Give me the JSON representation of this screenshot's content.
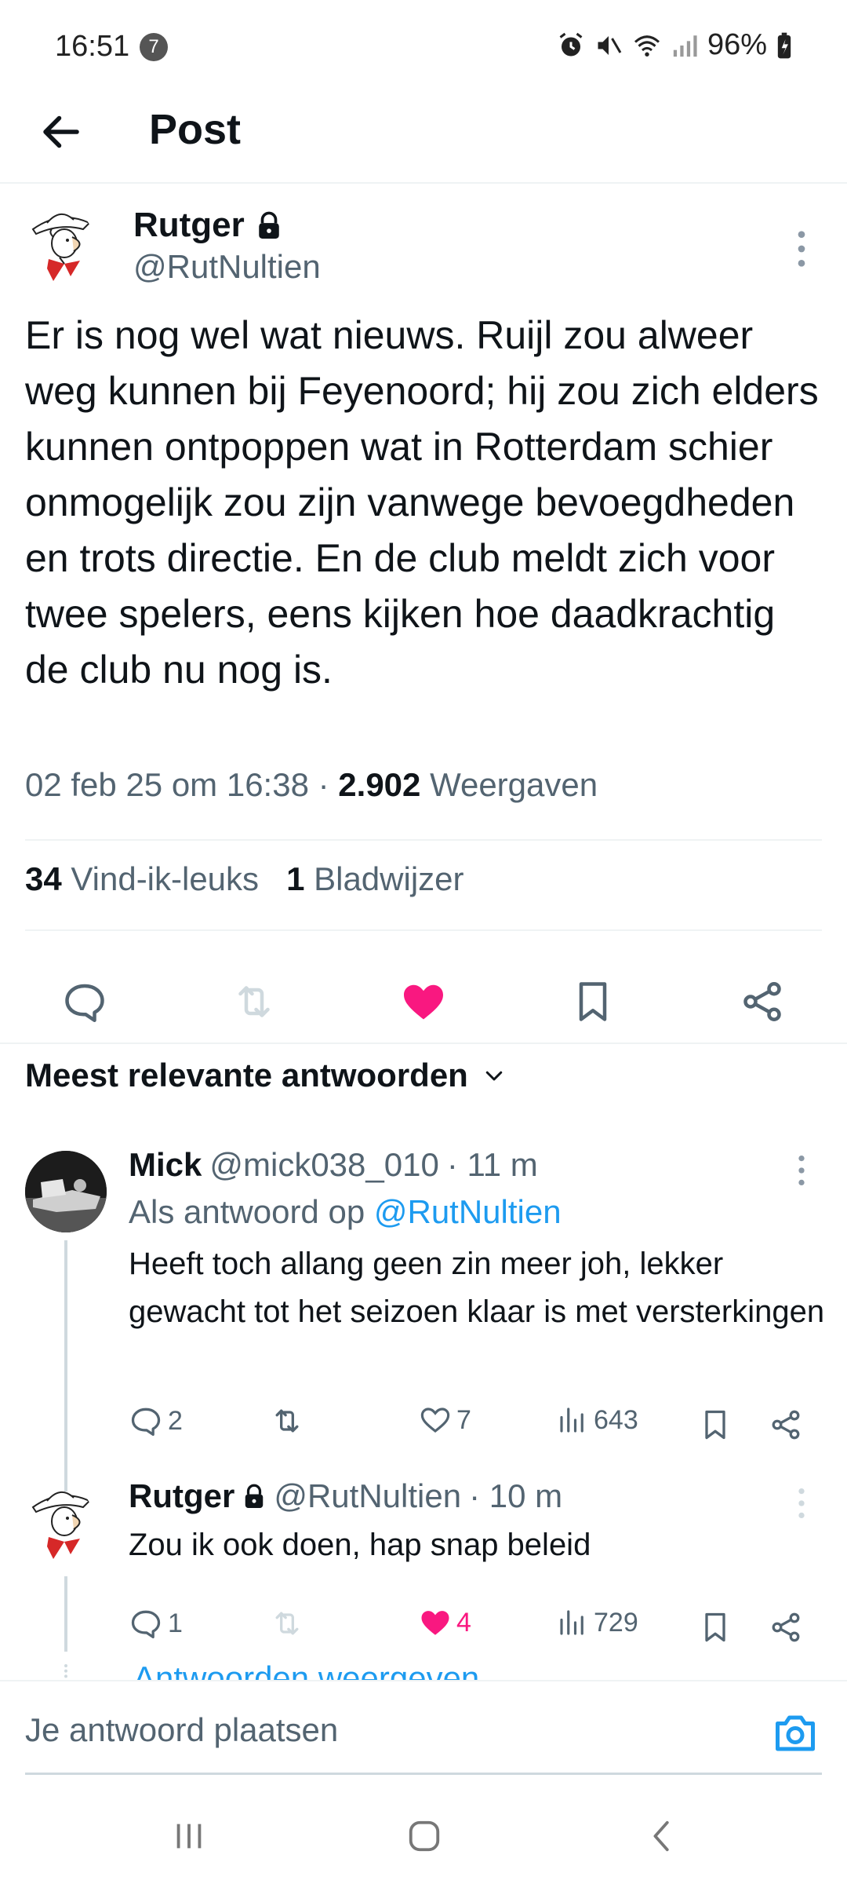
{
  "status_bar": {
    "time": "16:51",
    "notification_count": "7",
    "battery": "96%"
  },
  "header": {
    "title": "Post"
  },
  "post": {
    "author_name": "Rutger",
    "handle": "@RutNultien",
    "text": "Er is nog wel wat nieuws. Ruijl zou alweer weg kunnen bij Feyenoord; hij zou zich elders kunnen ontpoppen wat in Rotterdam schier onmogelijk zou zijn vanwege bevoegdheden en trots directie. En de club meldt zich voor twee spelers, eens kijken hoe daadkrachtig de club nu nog is.",
    "timestamp": "02 feb 25 om 16:38",
    "separator": "·",
    "views_count": "2.902",
    "views_label": "Weergaven",
    "likes_count": "34",
    "likes_label": "Vind-ik-leuks",
    "bookmarks_count": "1",
    "bookmarks_label": "Bladwijzer",
    "liked": true
  },
  "replies_section": {
    "sort_label": "Meest relevante antwoorden"
  },
  "replies": [
    {
      "name": "Mick",
      "handle": "@mick038_010",
      "time": "· 11 m",
      "context_prefix": "Als antwoord op",
      "context_mention": "@RutNultien",
      "text": "Heeft toch allang geen zin meer joh, lekker gewacht tot het seizoen klaar is met versterkingen",
      "reply_count": "2",
      "retweet_count": "",
      "like_count": "7",
      "view_count": "643",
      "liked": false
    },
    {
      "name": "Rutger",
      "handle": "@RutNultien",
      "time": "· 10 m",
      "text": "Zou ik ook doen, hap snap beleid",
      "reply_count": "1",
      "retweet_count": "",
      "like_count": "4",
      "view_count": "729",
      "liked": true
    }
  ],
  "show_replies_label": "Antwoorden weergeven",
  "compose": {
    "placeholder": "Je antwoord plaatsen"
  },
  "colors": {
    "accent": "#1d9bf0",
    "like": "#f91880",
    "muted": "#536471",
    "text": "#0f1419"
  }
}
